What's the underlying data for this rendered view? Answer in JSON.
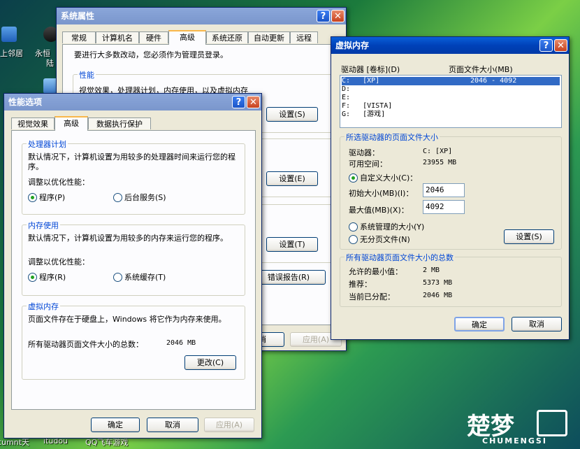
{
  "desktop": {
    "icons": [
      {
        "label": "上邻居"
      },
      {
        "label": "永恒"
      },
      {
        "label": "陆"
      }
    ],
    "bottom_labels": [
      "cumnt天",
      "itudou",
      "QQ飞车游戏"
    ],
    "watermark_brand": "楚梦",
    "watermark_sub": "CHUMENGSI"
  },
  "sysprops": {
    "title": "系统属性",
    "tabs": [
      "常规",
      "计算机名",
      "硬件",
      "高级",
      "系统还原",
      "自动更新",
      "远程"
    ],
    "admin_note": "要进行大多数改动，您必须作为管理员登录。",
    "perf_label": "性能",
    "perf_desc": "视觉效果，处理器计划，内存使用，以及虚拟内存",
    "settings_btn1": "设置(S)",
    "settings_btn2": "设置(E)",
    "settings_btn3": "设置(T)",
    "error_report_btn": "错误报告(R)",
    "cancel_btn": "取消",
    "apply_btn": "应用(A)"
  },
  "perfopts": {
    "title": "性能选项",
    "tabs": [
      "视觉效果",
      "高级",
      "数据执行保护"
    ],
    "cpu_group": "处理器计划",
    "cpu_desc": "默认情况下，计算机设置为用较多的处理器时间来运行您的程序。",
    "cpu_adjust": "调整以优化性能：",
    "cpu_opt_programs": "程序(P)",
    "cpu_opt_background": "后台服务(S)",
    "mem_group": "内存使用",
    "mem_desc": "默认情况下，计算机设置为用较多的内存来运行您的程序。",
    "mem_adjust": "调整以优化性能：",
    "mem_opt_programs": "程序(R)",
    "mem_opt_cache": "系统缓存(T)",
    "vm_group": "虚拟内存",
    "vm_desc": "页面文件存在于硬盘上，Windows 将它作为内存来使用。",
    "vm_total_label": "所有驱动器页面文件大小的总数：",
    "vm_total_value": "2046 MB",
    "change_btn": "更改(C)",
    "ok_btn": "确定",
    "cancel_btn": "取消",
    "apply_btn": "应用(A)"
  },
  "vmem": {
    "title": "虚拟内存",
    "col_drive": "驱动器 [卷标](D)",
    "col_size": "页面文件大小(MB)",
    "drives": [
      {
        "text": "C:   [XP]",
        "size": "2046 - 4092",
        "selected": true
      },
      {
        "text": "D:",
        "size": "",
        "selected": false
      },
      {
        "text": "E:",
        "size": "",
        "selected": false
      },
      {
        "text": "F:   [VISTA]",
        "size": "",
        "selected": false
      },
      {
        "text": "G:   [游戏]",
        "size": "",
        "selected": false
      }
    ],
    "sel_group": "所选驱动器的页面文件大小",
    "drive_label": "驱动器：",
    "drive_value": "C:  [XP]",
    "free_label": "可用空间：",
    "free_value": "23955 MB",
    "custom_size": "自定义大小(C)：",
    "initial_label": "初始大小(MB)(I)：",
    "initial_value": "2046",
    "max_label": "最大值(MB)(X)：",
    "max_value": "4092",
    "system_managed": "系统管理的大小(Y)",
    "no_paging": "无分页文件(N)",
    "set_btn": "设置(S)",
    "total_group": "所有驱动器页面文件大小的总数",
    "min_label": "允许的最小值：",
    "min_value": "2 MB",
    "rec_label": "推荐：",
    "rec_value": "5373 MB",
    "cur_label": "当前已分配：",
    "cur_value": "2046 MB",
    "ok_btn": "确定",
    "cancel_btn": "取消"
  }
}
